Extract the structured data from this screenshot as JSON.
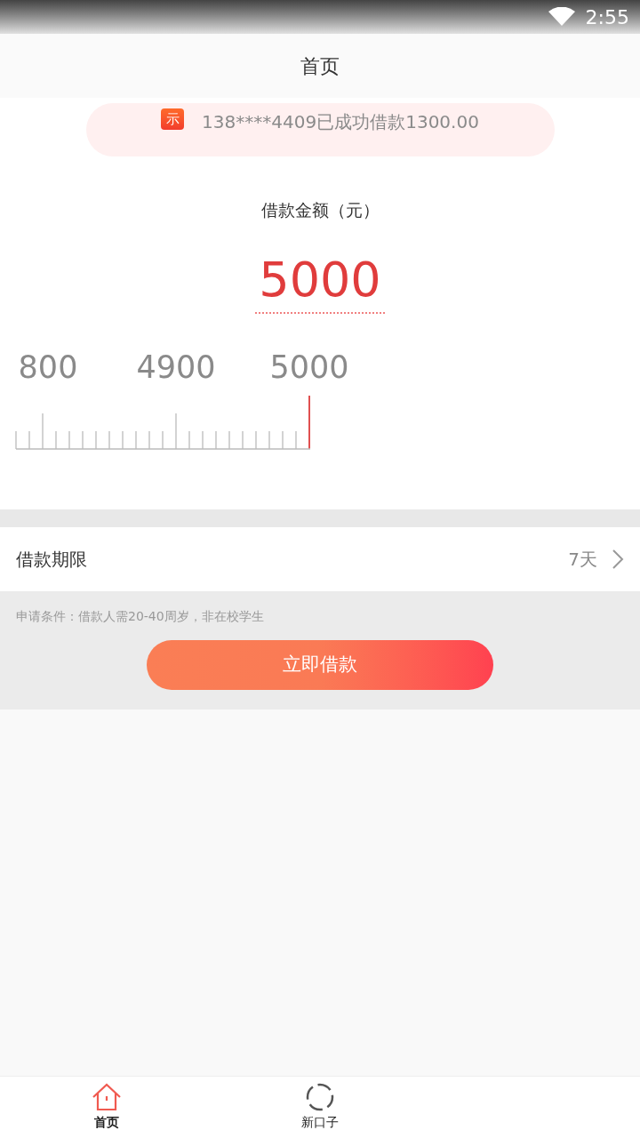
{
  "status_bar": {
    "time": "2:55"
  },
  "header": {
    "title": "首页"
  },
  "ticker": {
    "badge": "示",
    "message": "138****4409已成功借款1300.00"
  },
  "amount": {
    "label": "借款金额（元）",
    "value": "5000"
  },
  "ruler": {
    "labels": [
      "800",
      "4900",
      "5000"
    ]
  },
  "term": {
    "label": "借款期限",
    "value": "7天"
  },
  "conditions": "申请条件：借款人需20-40周岁，非在校学生",
  "apply_button": "立即借款",
  "tabs": [
    {
      "label": "首页",
      "selected": true,
      "kind": "home"
    },
    {
      "label": "新口子",
      "selected": false,
      "kind": "new"
    }
  ]
}
